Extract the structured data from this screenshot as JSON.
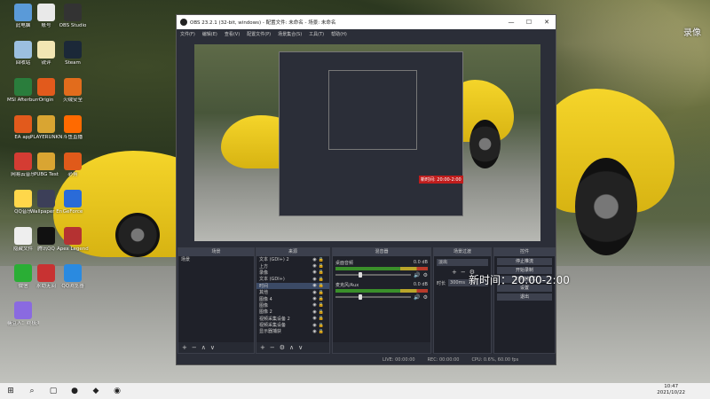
{
  "desktop": {
    "icons": [
      {
        "label": "此电脑",
        "color": "#5a9ad8"
      },
      {
        "label": "账号",
        "color": "#e9e9e9"
      },
      {
        "label": "OBS Studio",
        "color": "#333"
      },
      {
        "label": "回收站",
        "color": "#9bbfe0"
      },
      {
        "label": "锐评",
        "color": "#f2e6b3"
      },
      {
        "label": "Steam",
        "color": "#1b2838"
      },
      {
        "label": "MSI Afterburner",
        "color": "#2a7d3c"
      },
      {
        "label": "Origin",
        "color": "#e25a1c"
      },
      {
        "label": "火绒安全",
        "color": "#e26c1c"
      },
      {
        "label": "EA app",
        "color": "#e25a1c"
      },
      {
        "label": "PLAYERUNKNOWN'S BATTLEGROUNDS",
        "color": "#d9a532"
      },
      {
        "label": "斗鱼直播",
        "color": "#ff6a00"
      },
      {
        "label": "网易云音乐",
        "color": "#d43c33"
      },
      {
        "label": "PUBG Test",
        "color": "#d9a532"
      },
      {
        "label": "必剪",
        "color": "#e05a1a"
      },
      {
        "label": "QQ音乐",
        "color": "#ffd74a"
      },
      {
        "label": "Wallpaper Engine",
        "color": "#3c3f58"
      },
      {
        "label": "GeForce",
        "color": "#2a6bd8"
      },
      {
        "label": "隐藏文件",
        "color": "#eee"
      },
      {
        "label": "腾讯QQ",
        "color": "#111"
      },
      {
        "label": "Apex Legends",
        "color": "#b53232"
      },
      {
        "label": "微信",
        "color": "#2aae35"
      },
      {
        "label": "永劫无间",
        "color": "#c83232"
      },
      {
        "label": "QQ浏览器",
        "color": "#2a8ae0"
      },
      {
        "label": "糖豆人：终极淘汰赛",
        "color": "#8a6ae0"
      }
    ],
    "overlay_text": "录像"
  },
  "obs": {
    "title": "OBS 23.2.1 (32-bit, windows) - 配置文件: 未命名 - 场景: 未命名",
    "window_buttons": [
      "—",
      "☐",
      "✕"
    ],
    "menu": [
      "文件(F)",
      "编辑(E)",
      "查看(V)",
      "配置文件(P)",
      "场景集合(S)",
      "工具(T)",
      "帮助(H)"
    ],
    "preview_overlay_text": "新时间: 20:00-2:00",
    "docks": {
      "scenes": {
        "header": "场景",
        "items": [
          "场景"
        ],
        "footer": [
          "+",
          "−",
          "∧",
          "∨"
        ]
      },
      "sources": {
        "header": "来源",
        "items": [
          "文本 (GDI+) 2",
          "上方",
          "录像",
          "文本 (GDI+)",
          "时间",
          "其他",
          "图像 4",
          "图像",
          "图像 2",
          "视频采集设备 2",
          "视频采集设备",
          "显示器捕获"
        ],
        "selected_index": 4,
        "footer": [
          "+",
          "−",
          "⚙",
          "∧",
          "∨"
        ]
      },
      "mixer": {
        "header": "混音器",
        "channels": [
          {
            "name": "桌面音频",
            "db": "0.0 dB"
          },
          {
            "name": "麦克风/Aux",
            "db": "0.0 dB"
          }
        ]
      },
      "transitions": {
        "header": "场景过渡",
        "type": "淡出",
        "duration_label": "时长",
        "duration_value": "300ms"
      },
      "controls": {
        "header": "控件",
        "buttons": [
          "停止推流",
          "开始录制",
          "工作室模式",
          "设置",
          "退出"
        ]
      }
    },
    "status": {
      "live": "LIVE: 00:00:00",
      "rec": "REC: 00:00:00",
      "cpu": "CPU: 0.6%, 60.00 fps"
    }
  },
  "overlay_big_text": "新时间：20:00-2:00",
  "taskbar": {
    "time": "10:47",
    "date": "2021/10/22"
  }
}
